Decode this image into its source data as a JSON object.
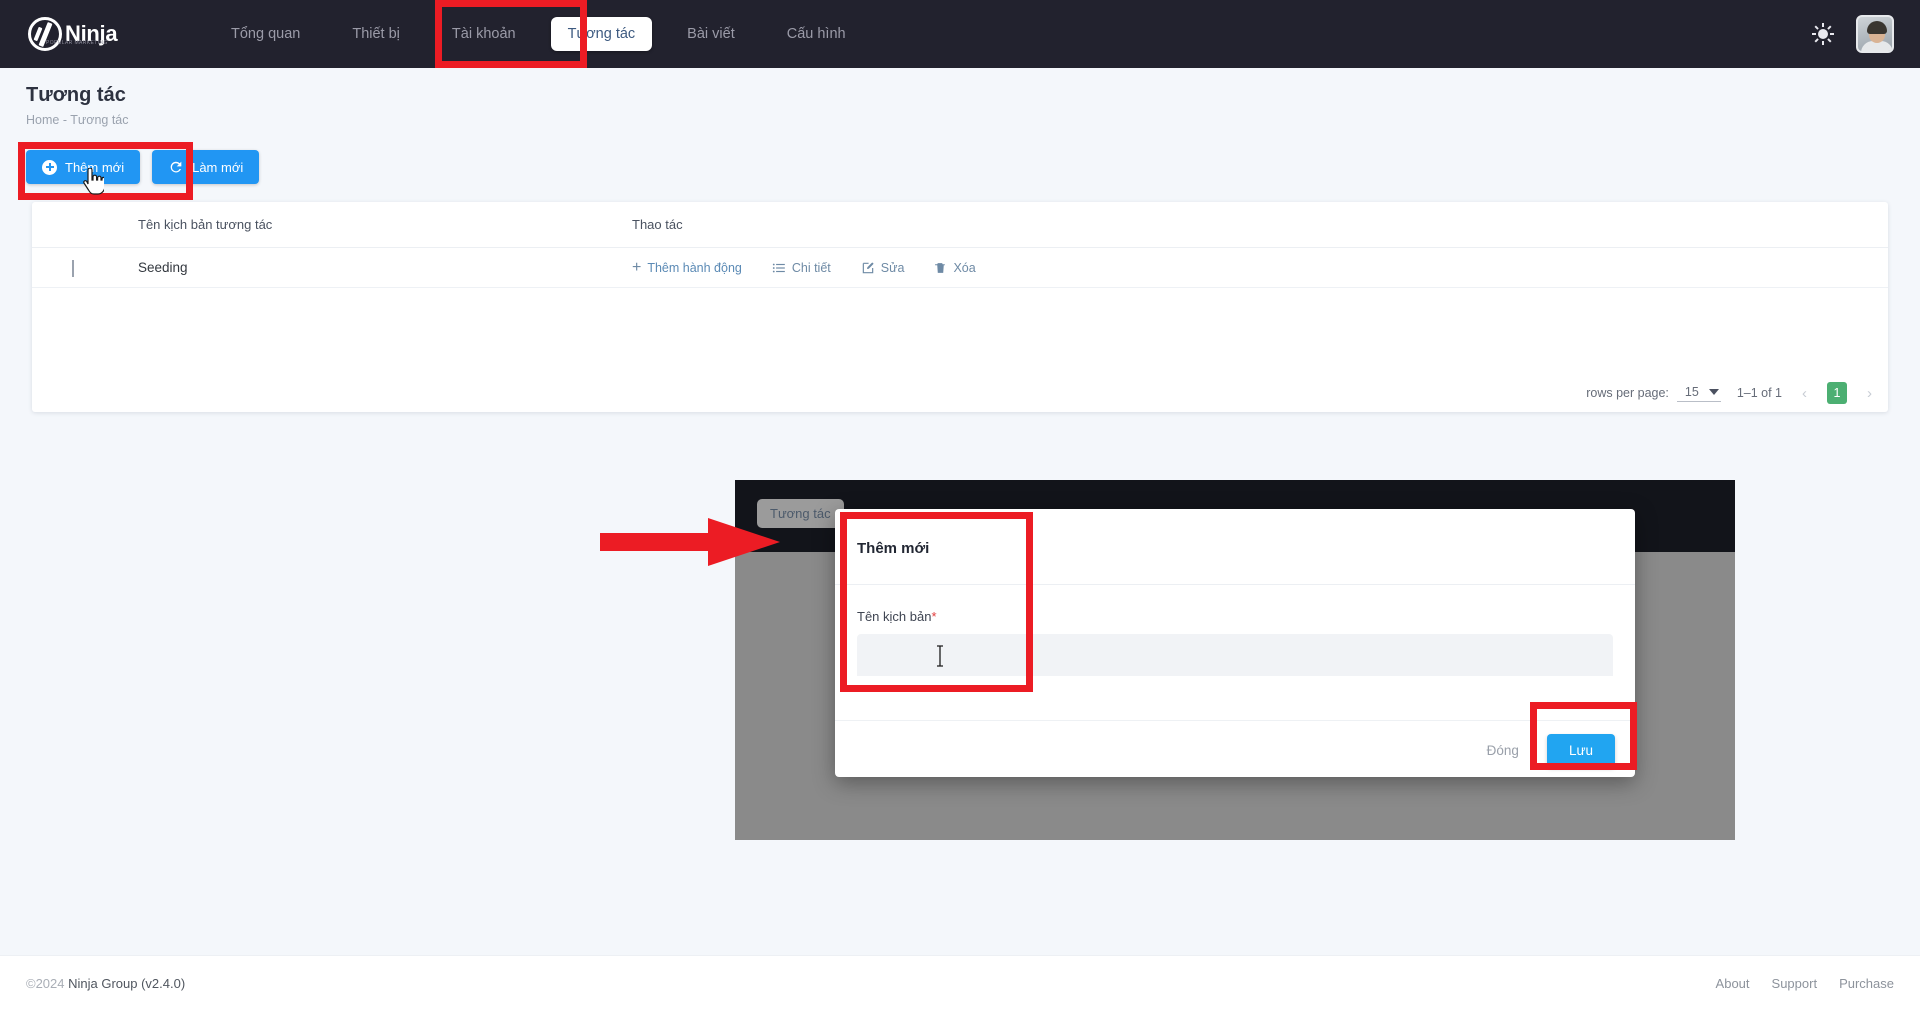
{
  "header": {
    "brand_name": "Ninja",
    "brand_tagline": "POPULAR MARKETING",
    "nav": [
      {
        "label": "Tổng quan",
        "active": false
      },
      {
        "label": "Thiết bị",
        "active": false
      },
      {
        "label": "Tài khoản",
        "active": false
      },
      {
        "label": "Tương tác",
        "active": true
      },
      {
        "label": "Bài viết",
        "active": false
      },
      {
        "label": "Cấu hình",
        "active": false
      }
    ],
    "theme_icon": "sun-icon",
    "avatar_icon": "user-avatar"
  },
  "page": {
    "title": "Tương tác",
    "breadcrumb_home": "Home",
    "breadcrumb_sep": "-",
    "breadcrumb_current": "Tương tác"
  },
  "toolbar": {
    "add_label": "Thêm mới",
    "refresh_label": "Làm mới"
  },
  "table": {
    "columns": {
      "name": "Tên kịch bản tương tác",
      "actions": "Thao tác"
    },
    "rows": [
      {
        "name": "Seeding",
        "actions": [
          {
            "label": "Thêm hành động",
            "icon": "plus-icon"
          },
          {
            "label": "Chi tiết",
            "icon": "list-icon"
          },
          {
            "label": "Sửa",
            "icon": "edit-icon"
          },
          {
            "label": "Xóa",
            "icon": "trash-icon"
          }
        ]
      }
    ]
  },
  "pagination": {
    "rows_per_page_label": "rows per page:",
    "rows_per_page_value": "15",
    "range_label": "1–1 of 1",
    "prev_symbol": "‹",
    "next_symbol": "›",
    "current_page": "1"
  },
  "modal_inset": {
    "tab_label": "Tương tác",
    "title": "Thêm mới",
    "field_label": "Tên kịch bản",
    "required_mark": "*",
    "field_value": "",
    "field_placeholder": "",
    "close_label": "Đóng",
    "save_label": "Lưu"
  },
  "footer": {
    "copyright_mark": "©2024",
    "copyright_text": "Ninja Group (v2.4.0)",
    "links": [
      "About",
      "Support",
      "Purchase"
    ]
  },
  "colors": {
    "accent_blue": "#2196f3",
    "page_bg": "#f4f7fb",
    "topbar_bg": "#22222e",
    "highlight_red": "#ec1c24",
    "page_green": "#4caf72"
  }
}
